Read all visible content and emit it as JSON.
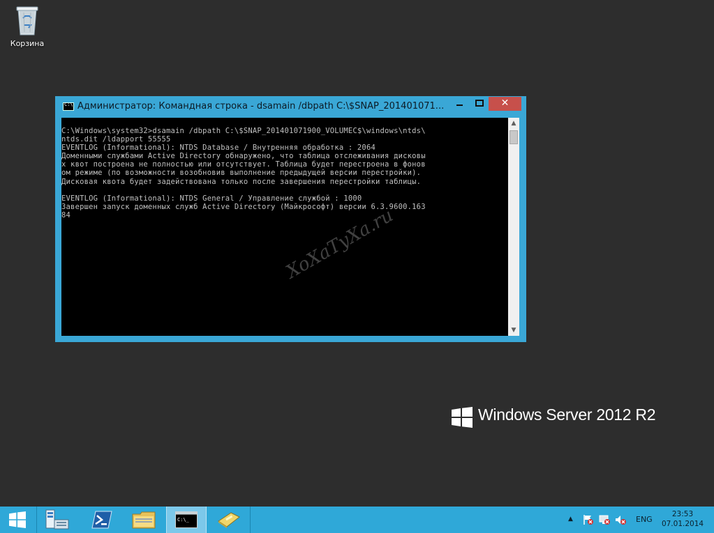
{
  "desktop": {
    "recycle_bin": {
      "label": "Корзина",
      "icon": "recycle-bin-icon"
    }
  },
  "console_window": {
    "title": "Администратор: Командная строка - dsamain  /dbpath C:\\$SNAP_201401071...",
    "content": "C:\\Windows\\system32>dsamain /dbpath C:\\$SNAP_201401071900_VOLUMEC$\\windows\\ntds\\\nntds.dit /ldapport 55555\nEVENTLOG (Informational): NTDS Database / Внутренняя обработка : 2064\nДоменными службами Active Directory обнаружено, что таблица отслеживания дисковы\nх квот построена не полностью или отсутствует. Таблица будет перестроена в фонов\nом режиме (по возможности возобновив выполнение предыдущей версии перестройки).\nДисковая квота будет задействована только после завершения перестройки таблицы.\n\nEVENTLOG (Informational): NTDS General / Управление службой : 1000\nЗавершен запуск доменных служб Active Directory (Майкрософт) версии 6.3.9600.163\n84\n",
    "watermark": "XoXaTyXa.ru",
    "colors": {
      "frame": "#3aa7d6",
      "close": "#c7504b",
      "console_bg": "#000000",
      "console_fg": "#c0c0c0"
    }
  },
  "branding": {
    "text": "Windows Server 2012 R2"
  },
  "taskbar": {
    "buttons": [
      {
        "name": "start",
        "icon": "windows-start-icon"
      },
      {
        "name": "server-manager",
        "icon": "server-manager-icon"
      },
      {
        "name": "powershell",
        "icon": "powershell-icon"
      },
      {
        "name": "file-explorer",
        "icon": "folder-icon"
      },
      {
        "name": "command-prompt",
        "icon": "cmd-icon",
        "active": true
      },
      {
        "name": "other-app",
        "icon": "app-icon"
      }
    ],
    "tray": {
      "language": "ENG",
      "time": "23:53",
      "date": "07.01.2014"
    },
    "color": "#2fa8d8"
  }
}
